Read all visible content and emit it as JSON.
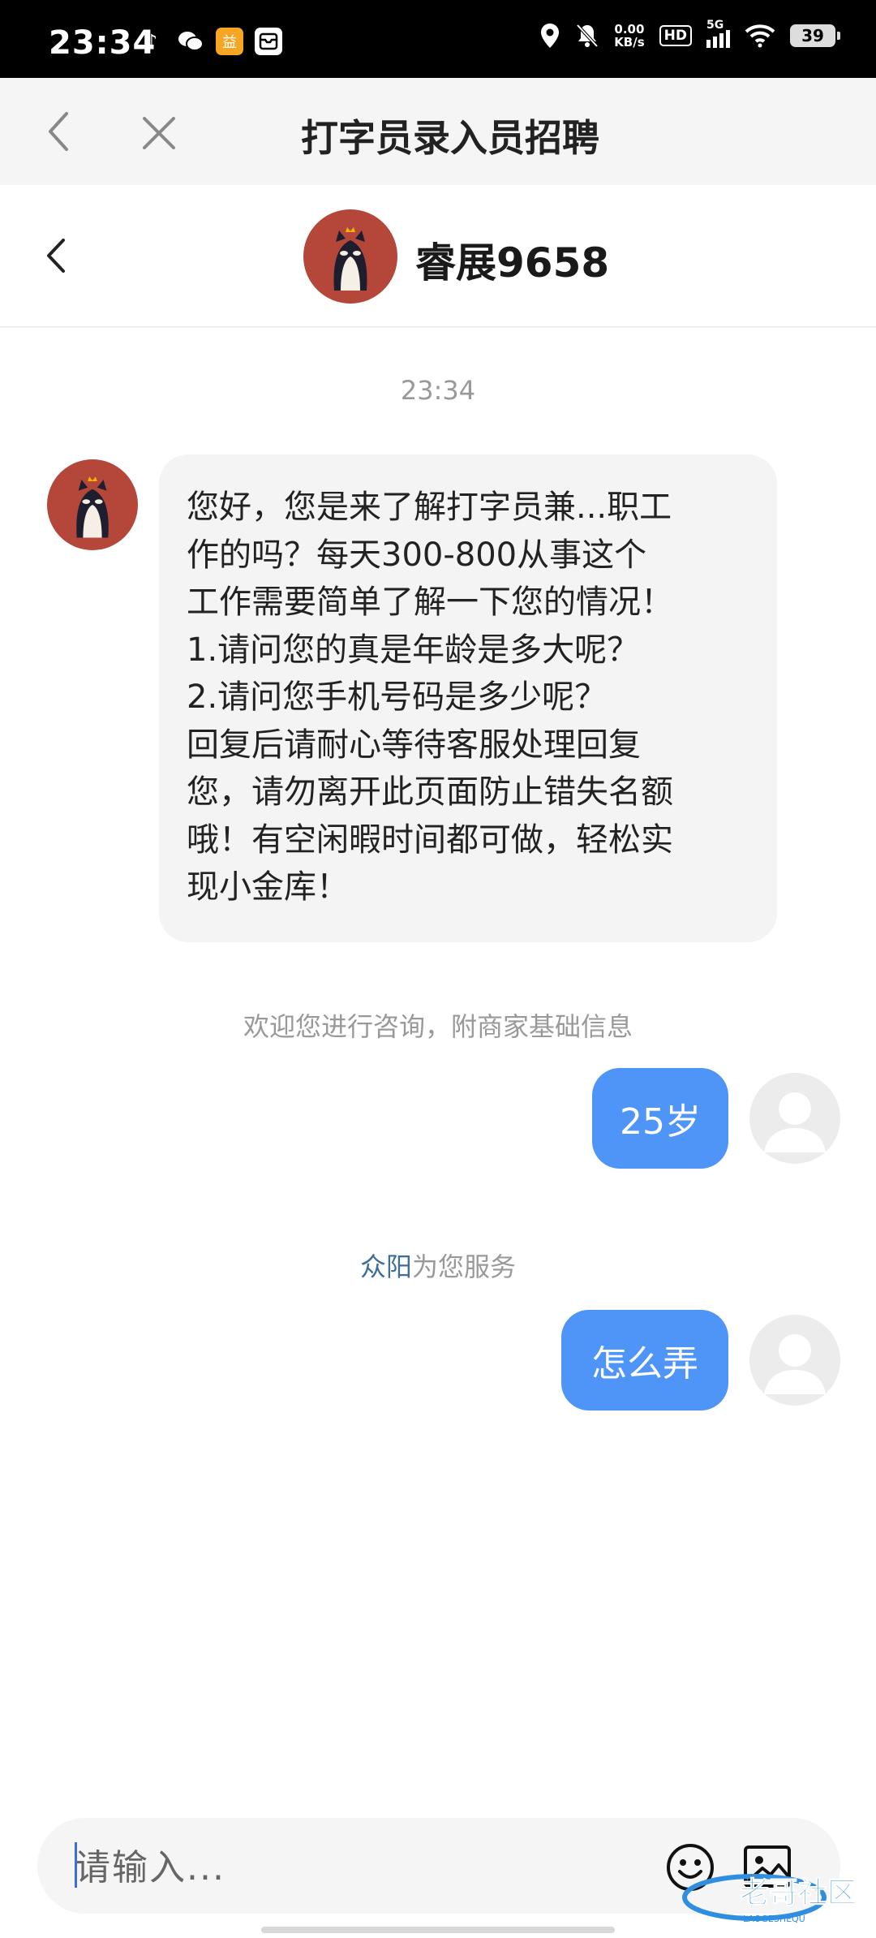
{
  "status_bar": {
    "time": "23:34",
    "net_speed_value": "0.00",
    "net_speed_unit": "KB/s",
    "hd_label": "HD",
    "network_type": "5G",
    "battery": "39"
  },
  "browser": {
    "title": "打字员录入员招聘"
  },
  "chat": {
    "contact_name": "睿展9658",
    "timestamp": "23:34",
    "agent_message_lines": [
      "您好，您是来了解打字员兼...职工",
      "作的吗？每天300-800从事这个",
      "工作需要简单了解一下您的情况！",
      "1.请问您的真是年龄是多大呢？",
      "2.请问您手机号码是多少呢？",
      "回复后请耐心等待客服处理回复",
      "您，请勿离开此页面防止错失名额",
      "哦！有空闲暇时间都可做，轻松实",
      "现小金库！"
    ],
    "system_note_1": "欢迎您进行咨询，附商家基础信息",
    "user_message_1": "25岁",
    "service_name": "众阳",
    "service_suffix": "为您服务",
    "user_message_2": "怎么弄"
  },
  "input": {
    "placeholder": "请输入..."
  },
  "watermark": {
    "text": "老哥社区",
    "sub": "LAOGESHEQU"
  },
  "colors": {
    "accent_blue": "#4f94f7",
    "avatar_red": "#b5473a",
    "service_name_color": "#3d6e9b"
  }
}
